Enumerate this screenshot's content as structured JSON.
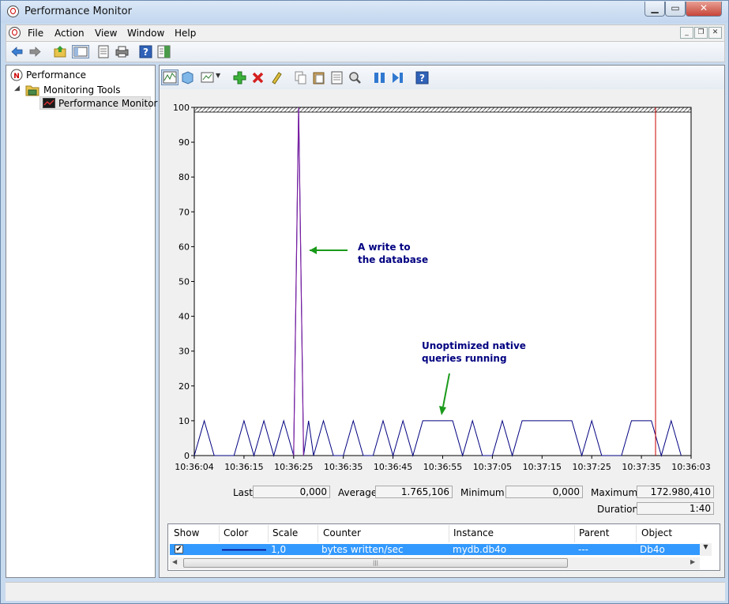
{
  "window": {
    "title": "Performance Monitor"
  },
  "menu": [
    "File",
    "Action",
    "View",
    "Window",
    "Help"
  ],
  "tree": {
    "root": "Performance",
    "folder": "Monitoring Tools",
    "selected": "Performance Monitor"
  },
  "annotations": {
    "write": "A write to\nthe database",
    "queries": "Unoptimized native\nqueries running"
  },
  "stats": {
    "last_label": "Last",
    "last": "0,000",
    "average_label": "Average",
    "average": "1.765,106",
    "minimum_label": "Minimum",
    "minimum": "0,000",
    "maximum_label": "Maximum",
    "maximum": "172.980,410",
    "duration_label": "Duration",
    "duration": "1:40"
  },
  "grid": {
    "headers": [
      "Show",
      "Color",
      "Scale",
      "Counter",
      "Instance",
      "Parent",
      "Object"
    ],
    "row": {
      "show": true,
      "scale": "1,0",
      "counter": "bytes written/sec",
      "instance": "mydb.db4o",
      "parent": "---",
      "object": "Db4o"
    }
  },
  "colors": {
    "series": "#000080",
    "spike": "#7b1fa2",
    "cursor": "#cc0000",
    "annotation_arrow": "#1a9a1a"
  },
  "chart_data": {
    "type": "line",
    "ylim": [
      0,
      100
    ],
    "y_ticks": [
      0,
      10,
      20,
      30,
      40,
      50,
      60,
      70,
      80,
      90,
      100
    ],
    "x_tick_labels": [
      "10:36:04",
      "10:36:15",
      "10:36:25",
      "10:36:35",
      "10:36:45",
      "10:36:55",
      "10:37:05",
      "10:37:15",
      "10:37:25",
      "10:37:35",
      "10:36:03"
    ],
    "series": [
      {
        "x": [
          "10:36:04",
          "10:36:06",
          "10:36:08",
          "10:36:10",
          "10:36:12",
          "10:36:14",
          "10:36:16",
          "10:36:18",
          "10:36:20",
          "10:36:22",
          "10:36:24",
          "10:36:25",
          "10:36:26",
          "10:36:27",
          "10:36:28",
          "10:36:30",
          "10:36:32",
          "10:36:34",
          "10:36:36",
          "10:36:38",
          "10:36:40",
          "10:36:42",
          "10:36:44",
          "10:36:46",
          "10:36:48",
          "10:36:50",
          "10:36:52",
          "10:36:54",
          "10:36:56",
          "10:36:58",
          "10:37:00",
          "10:37:02",
          "10:37:04",
          "10:37:06",
          "10:37:08",
          "10:37:10",
          "10:37:12",
          "10:37:14",
          "10:37:16",
          "10:37:18",
          "10:37:20",
          "10:37:22",
          "10:37:24",
          "10:37:26",
          "10:37:28",
          "10:37:30",
          "10:37:32",
          "10:37:34",
          "10:37:36",
          "10:37:38",
          "10:37:40",
          "10:37:42"
        ],
        "values": [
          0,
          10,
          0,
          0,
          0,
          10,
          0,
          10,
          0,
          10,
          0,
          100,
          0,
          10,
          0,
          10,
          0,
          0,
          10,
          0,
          0,
          10,
          0,
          10,
          0,
          10,
          10,
          10,
          10,
          0,
          10,
          0,
          0,
          10,
          0,
          10,
          10,
          10,
          10,
          10,
          10,
          0,
          10,
          0,
          0,
          0,
          10,
          10,
          10,
          0,
          10,
          0
        ]
      }
    ]
  }
}
